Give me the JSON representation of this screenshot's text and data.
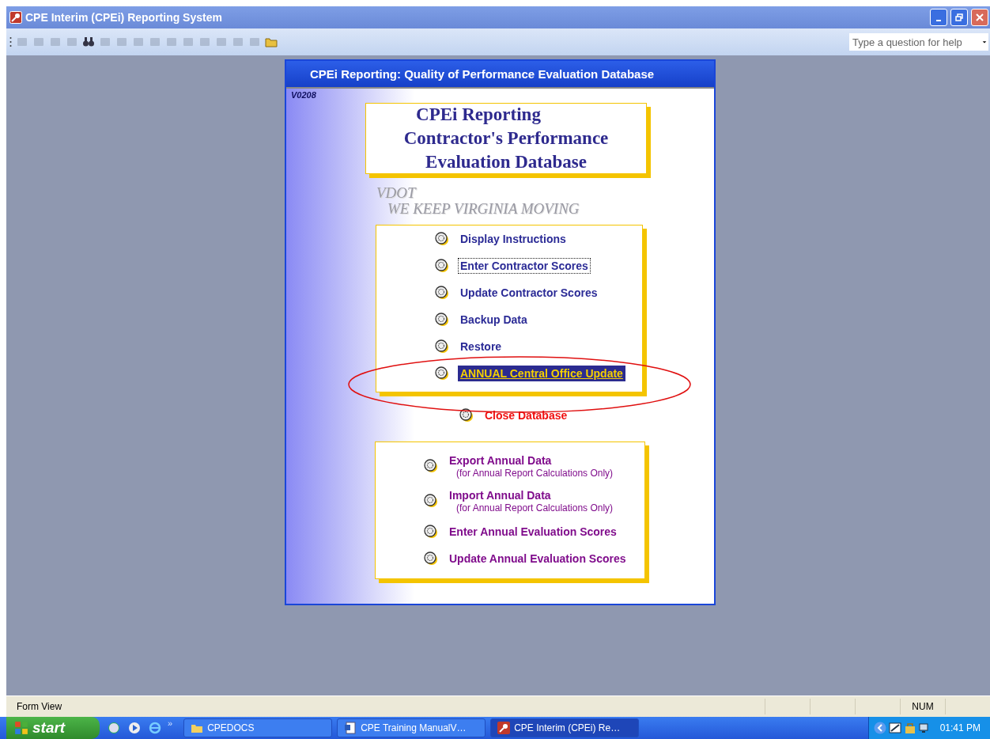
{
  "window": {
    "title": "CPE Interim (CPEi) Reporting System"
  },
  "help": {
    "placeholder": "Type a question for help"
  },
  "form": {
    "title": "CPEi Reporting:  Quality of Performance Evaluation Database",
    "version": "V0208",
    "heading": [
      "CPEi Reporting",
      "Contractor's Performance",
      "Evaluation  Database"
    ],
    "logo": [
      "VDOT",
      "WE KEEP VIRGINIA MOVING"
    ],
    "sections": [
      {
        "kind": "main",
        "items": [
          {
            "label": "Display Instructions",
            "selected": false,
            "focused": false
          },
          {
            "label": "Enter Contractor Scores",
            "selected": false,
            "focused": true
          },
          {
            "label": "Update Contractor Scores",
            "selected": false,
            "focused": false
          },
          {
            "label": "Backup Data",
            "selected": false,
            "focused": false
          },
          {
            "label": "Restore",
            "selected": false,
            "focused": false
          },
          {
            "label": "ANNUAL Central Office Update",
            "selected": true,
            "focused": false
          }
        ]
      },
      {
        "kind": "close",
        "items": [
          {
            "label": "Close Database",
            "selected": false,
            "focused": false
          }
        ]
      },
      {
        "kind": "annual",
        "items": [
          {
            "label": "Export Annual Data",
            "note": "(for Annual Report Calculations Only)",
            "selected": false,
            "focused": false
          },
          {
            "label": "Import Annual Data",
            "note": "(for Annual Report Calculations Only)",
            "selected": false,
            "focused": false
          },
          {
            "label": "Enter Annual Evaluation Scores",
            "selected": false,
            "focused": false
          },
          {
            "label": "Update Annual Evaluation Scores",
            "selected": false,
            "focused": false
          }
        ]
      }
    ]
  },
  "status_bar": {
    "mode": "Form View",
    "indicator": "NUM"
  },
  "taskbar": {
    "start": "start",
    "quick_launch_more": "»",
    "tasks": [
      {
        "label": "CPEDOCS",
        "kind": "folder",
        "selected": false
      },
      {
        "label": "CPE Training ManualV…",
        "kind": "document",
        "selected": false
      },
      {
        "label": "CPE Interim (CPEi) Re…",
        "kind": "app",
        "selected": true
      }
    ],
    "clock": "01:41 PM"
  }
}
